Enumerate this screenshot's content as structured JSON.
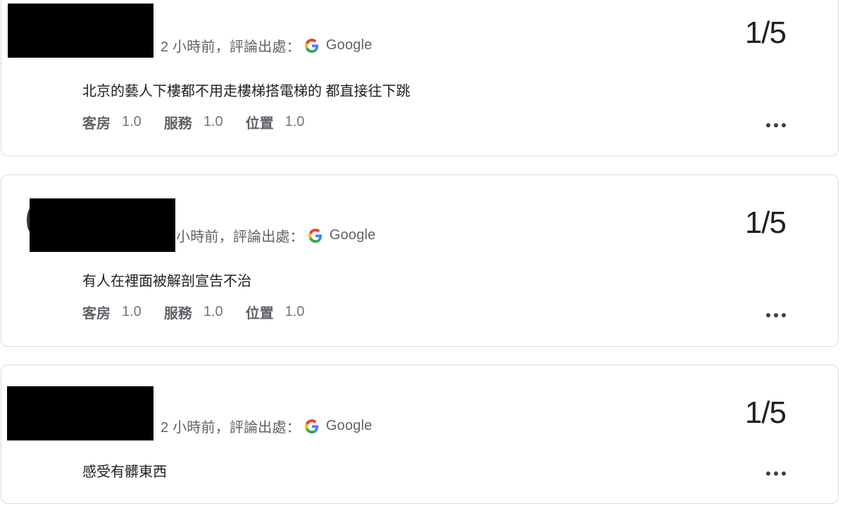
{
  "reviews": [
    {
      "meta_time": "2 小時前，評論出處：",
      "source": "Google",
      "score": "1/5",
      "text": "北京的藝人下樓都不用走樓梯搭電梯的 都直接往下跳",
      "ratings": [
        {
          "label": "客房",
          "value": "1.0"
        },
        {
          "label": "服務",
          "value": "1.0"
        },
        {
          "label": "位置",
          "value": "1.0"
        }
      ]
    },
    {
      "meta_time": "小時前，評論出處：",
      "source": "Google",
      "score": "1/5",
      "text": "有人在裡面被解剖宣告不治",
      "ratings": [
        {
          "label": "客房",
          "value": "1.0"
        },
        {
          "label": "服務",
          "value": "1.0"
        },
        {
          "label": "位置",
          "value": "1.0"
        }
      ]
    },
    {
      "meta_time": "2 小時前，評論出處：",
      "source": "Google",
      "score": "1/5",
      "text": "感受有髒東西"
    }
  ],
  "icons": {
    "source_logo": "google-g-icon",
    "more": "more-horiz-icon"
  },
  "colors": {
    "border": "#dadce0",
    "text": "#202124",
    "muted": "#5f6368",
    "redaction": "#000000"
  }
}
